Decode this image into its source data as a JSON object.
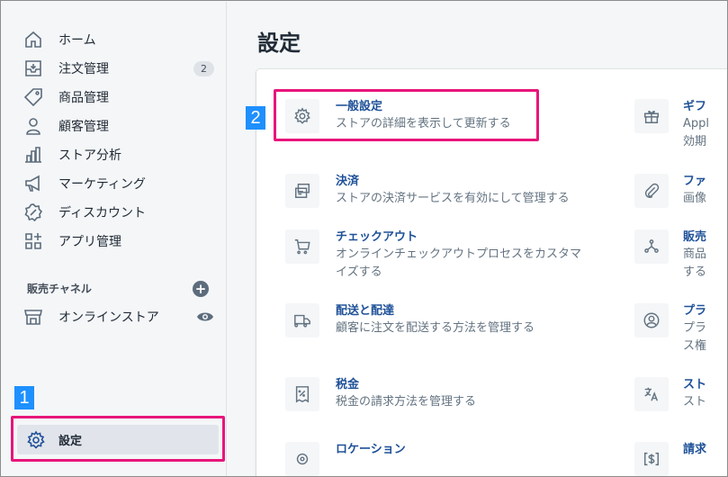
{
  "sidebar": {
    "items": [
      {
        "label": "ホーム",
        "icon": "home-icon"
      },
      {
        "label": "注文管理",
        "icon": "orders-icon",
        "badge": "2"
      },
      {
        "label": "商品管理",
        "icon": "tag-icon"
      },
      {
        "label": "顧客管理",
        "icon": "customer-icon"
      },
      {
        "label": "ストア分析",
        "icon": "analytics-icon"
      },
      {
        "label": "マーケティング",
        "icon": "megaphone-icon"
      },
      {
        "label": "ディスカウント",
        "icon": "discount-icon"
      },
      {
        "label": "アプリ管理",
        "icon": "apps-icon"
      }
    ],
    "channels_title": "販売チャネル",
    "online_store": "オンラインストア",
    "settings": "設定"
  },
  "markers": {
    "one": "1",
    "two": "2"
  },
  "main": {
    "title": "設定",
    "left": [
      {
        "title": "一般設定",
        "desc": [
          "ストアの詳細を表示して更新する"
        ],
        "icon": "gear-icon"
      },
      {
        "title": "決済",
        "desc": [
          "ストアの決済サービスを有効にして管理する"
        ],
        "icon": "payment-icon"
      },
      {
        "title": "チェックアウト",
        "desc": [
          "オンラインチェックアウトプロセスをカスタマ",
          "イズする"
        ],
        "icon": "cart-icon"
      },
      {
        "title": "配送と配達",
        "desc": [
          "顧客に注文を配送する方法を管理する"
        ],
        "icon": "truck-icon"
      },
      {
        "title": "税金",
        "desc": [
          "税金の請求方法を管理する"
        ],
        "icon": "tax-icon"
      },
      {
        "title": "ロケーション",
        "desc": [],
        "icon": "location-icon"
      }
    ],
    "right": [
      {
        "title": "ギフ",
        "desc": [
          "Appl",
          "効期"
        ],
        "icon": "gift-icon"
      },
      {
        "title": "ファ",
        "desc": [
          "画像"
        ],
        "icon": "paperclip-icon"
      },
      {
        "title": "販売",
        "desc": [
          "商品",
          "する"
        ],
        "icon": "channels-icon"
      },
      {
        "title": "プラ",
        "desc": [
          "プラ",
          "ス権"
        ],
        "icon": "account-icon"
      },
      {
        "title": "スト",
        "desc": [
          "スト"
        ],
        "icon": "language-icon"
      },
      {
        "title": "請求",
        "desc": [],
        "icon": "billing-icon"
      }
    ]
  }
}
